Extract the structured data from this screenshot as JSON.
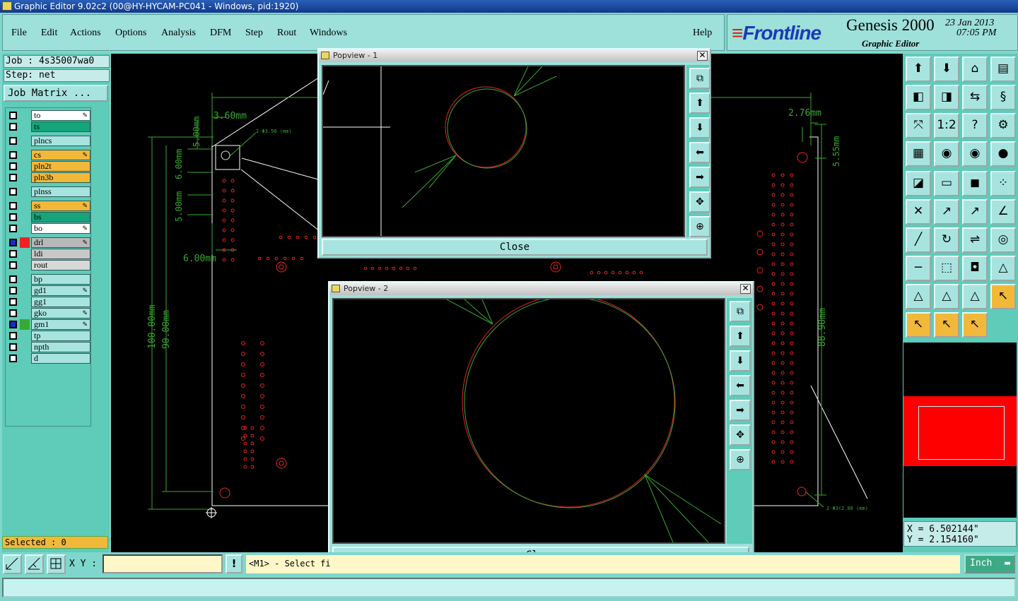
{
  "window": {
    "title": "Graphic Editor 9.02c2 (00@HY-HYCAM-PC041 - Windows, pid:1920)"
  },
  "menu": {
    "items": [
      "File",
      "Edit",
      "Actions",
      "Options",
      "Analysis",
      "DFM",
      "Step",
      "Rout",
      "Windows"
    ],
    "help": "Help"
  },
  "brand": {
    "logo": "Frontline",
    "product": "Genesis 2000",
    "date": "23 Jan 2013",
    "time": "07:05 PM",
    "subtitle": "Graphic Editor"
  },
  "job": {
    "job_label": "Job : 4s35007wa0",
    "step_label": "Step: net",
    "matrix_button": "Job Matrix ..."
  },
  "layers": [
    {
      "name": "to",
      "color": "#ffffff",
      "marked": true,
      "affected": false
    },
    {
      "name": "ts",
      "color": "#16a47a",
      "marked": false,
      "affected": false
    },
    {
      "name": "plncs",
      "color": "#a8e4df",
      "marked": false,
      "affected": false
    },
    {
      "name": "cs",
      "color": "#f2b83a",
      "marked": true,
      "affected": false
    },
    {
      "name": "pln2t",
      "color": "#f2b83a",
      "marked": false,
      "affected": false
    },
    {
      "name": "pln3b",
      "color": "#f2b83a",
      "marked": false,
      "affected": false
    },
    {
      "name": "plnss",
      "color": "#a8e4df",
      "marked": false,
      "affected": false
    },
    {
      "name": "ss",
      "color": "#f2b83a",
      "marked": true,
      "affected": false
    },
    {
      "name": "bs",
      "color": "#16a47a",
      "marked": false,
      "affected": false
    },
    {
      "name": "bo",
      "color": "#ffffff",
      "marked": true,
      "affected": false
    },
    {
      "name": "drl",
      "color": "#b8b8b8",
      "marked": true,
      "affected": true,
      "swatch": "#ee2222"
    },
    {
      "name": "ldi",
      "color": "#c8c8c8",
      "marked": false,
      "affected": false
    },
    {
      "name": "rout",
      "color": "#d8d8d8",
      "marked": false,
      "affected": false
    },
    {
      "name": "bp",
      "color": "#a8e4df",
      "marked": false,
      "affected": false
    },
    {
      "name": "gd1",
      "color": "#a8e4df",
      "marked": true,
      "affected": false
    },
    {
      "name": "gg1",
      "color": "#a8e4df",
      "marked": false,
      "affected": false
    },
    {
      "name": "gko",
      "color": "#a8e4df",
      "marked": true,
      "affected": false
    },
    {
      "name": "gm1",
      "color": "#a8e4df",
      "marked": true,
      "affected": true,
      "swatch": "#3aa832"
    },
    {
      "name": "tp",
      "color": "#a8e4df",
      "marked": false,
      "affected": false
    },
    {
      "name": "npth",
      "color": "#a8e4df",
      "marked": false,
      "affected": false
    },
    {
      "name": "d",
      "color": "#a8e4df",
      "marked": false,
      "affected": false
    }
  ],
  "selected": "Selected : 0",
  "dimensions": [
    "3.60mm",
    "5.00mm",
    "6.00mm",
    "5.00mm",
    "6.00mm",
    "100.00mm",
    "90.00mm",
    "2.76mm",
    "5.55mm",
    "88.90mm",
    "2-Φ3.50 (mm)",
    "2-Φ3(2.00 (mm)"
  ],
  "popview1": {
    "title": "Popview - 1",
    "close": "Close"
  },
  "popview2": {
    "title": "Popview - 2",
    "close": "Close"
  },
  "coords": {
    "x": "X = 6.502144\"",
    "y": "Y = 2.154160\""
  },
  "bottom": {
    "xy_label": "X Y :",
    "xy_value": "",
    "message": "<M1> - Select fi",
    "units": "Inch"
  },
  "colors": {
    "panel": "#5fcbb9",
    "drill": "#ee2222",
    "outline": "#3aa832"
  }
}
